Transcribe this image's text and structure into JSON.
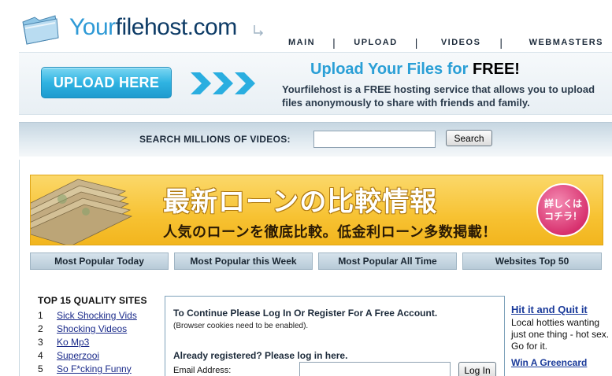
{
  "logo": {
    "text_part1": "Your",
    "text_part2": "filehost.com",
    "icon": "folder-icon"
  },
  "nav": {
    "items": [
      {
        "label": "MAIN"
      },
      {
        "label": "UPLOAD"
      },
      {
        "label": "VIDEOS"
      },
      {
        "label": "WEBMASTERS"
      }
    ],
    "separator": "|"
  },
  "upload_banner": {
    "button_label": "UPLOAD HERE",
    "title": "Upload Your Files for ",
    "title_emphasis": "FREE!",
    "description": "Yourfilehost is a FREE hosting service that allows you to upload files anonymously to share with friends and family."
  },
  "search": {
    "label": "SEARCH MILLIONS OF VIDEOS:",
    "value": "",
    "button_label": "Search"
  },
  "ad_banner": {
    "line1": "最新ローンの比較情報",
    "line2": "人気のローンを徹底比較。低金利ローン多数掲載！",
    "badge_line1": "詳しくは",
    "badge_line2": "コチラ！"
  },
  "tabs": [
    {
      "label": "Most Popular Today"
    },
    {
      "label": "Most Popular this Week"
    },
    {
      "label": "Most Popular All Time"
    },
    {
      "label": "Websites Top 50"
    }
  ],
  "sites": {
    "title": "TOP 15 QUALITY SITES",
    "items": [
      {
        "num": "1",
        "label": "Sick Shocking Vids"
      },
      {
        "num": "2",
        "label": "Shocking Videos"
      },
      {
        "num": "3",
        "label": "Ko Mp3"
      },
      {
        "num": "4",
        "label": "Superzooi"
      },
      {
        "num": "5",
        "label": "So F*cking Funny"
      }
    ]
  },
  "login": {
    "title": "To Continue Please Log In Or Register For A Free Account.",
    "note": "(Browser cookies need to be enabled).",
    "subtitle": "Already registered? Please log in here.",
    "email_label": "Email Address:",
    "email_value": "",
    "button_label": "Log In"
  },
  "right_ad": {
    "title": "Hit it and Quit it",
    "text": "Local hotties wanting just one thing - hot sex. Go for it.",
    "title2": "Win A Greencard"
  },
  "colors": {
    "brand_blue": "#2f9ad6",
    "brand_navy": "#0d3b66",
    "ad_yellow": "#f7c232",
    "link_blue": "#1a3a9a"
  }
}
